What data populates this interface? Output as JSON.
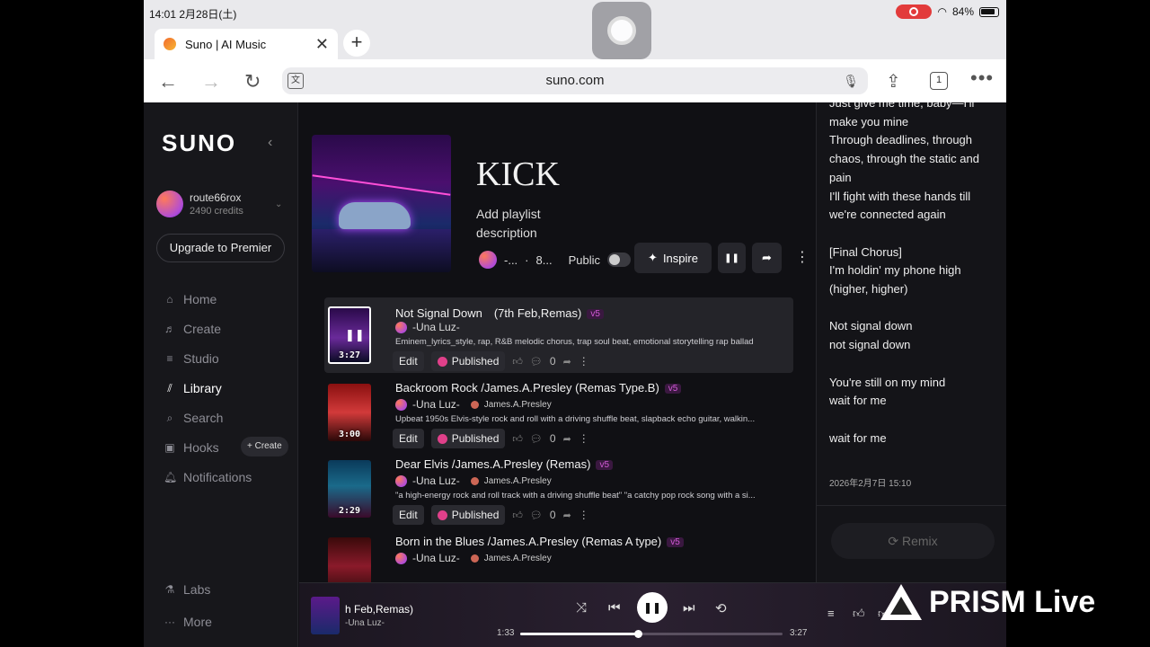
{
  "statusbar": {
    "time": "14:01  2月28日(土)",
    "battery": "84%"
  },
  "browser": {
    "tab_title": "Suno | AI Music",
    "url": "suno.com",
    "tab_count": "1"
  },
  "sidebar": {
    "logo": "SUNO",
    "username": "route66rox",
    "credits": "2490 credits",
    "upgrade": "Upgrade to Premier",
    "items": [
      {
        "label": "Home",
        "icon": "home-icon"
      },
      {
        "label": "Create",
        "icon": "music-note-icon"
      },
      {
        "label": "Studio",
        "icon": "studio-icon"
      },
      {
        "label": "Library",
        "icon": "library-icon"
      },
      {
        "label": "Search",
        "icon": "search-icon"
      },
      {
        "label": "Hooks",
        "icon": "hooks-icon"
      },
      {
        "label": "Notifications",
        "icon": "bell-icon"
      },
      {
        "label": "Labs",
        "icon": "flask-icon"
      },
      {
        "label": "More",
        "icon": "more-icon"
      }
    ],
    "hooks_create": "+ Create"
  },
  "playlist": {
    "title": "KICK",
    "description": "Add playlist description",
    "owner_short": "-...",
    "count_short": "8...",
    "public_label": "Public",
    "inspire": "Inspire"
  },
  "songs": [
    {
      "title": "Not Signal Down　(7th Feb,Remas)",
      "version": "v5",
      "artist": "-Una Luz-",
      "collab": "",
      "tags": "Eminem_lyrics_style, rap, R&B melodic chorus, trap soul beat, emotional storytelling rap ballad",
      "duration": "3:27",
      "edit": "Edit",
      "status": "Published",
      "comments": "0"
    },
    {
      "title": "Backroom Rock /James.A.Presley (Remas Type.B)",
      "version": "v5",
      "artist": "-Una Luz-",
      "collab": "James.A.Presley",
      "tags": "Upbeat 1950s Elvis-style rock and roll with a driving shuffle beat, slapback echo guitar, walkin...",
      "duration": "3:00",
      "edit": "Edit",
      "status": "Published",
      "comments": "0"
    },
    {
      "title": "Dear Elvis /James.A.Presley (Remas)",
      "version": "v5",
      "artist": "-Una Luz-",
      "collab": "James.A.Presley",
      "tags": "\"a high-energy rock and roll track with a driving shuffle beat\" \"a catchy pop rock song with a si...",
      "duration": "2:29",
      "edit": "Edit",
      "status": "Published",
      "comments": "0"
    },
    {
      "title": "Born in the Blues /James.A.Presley (Remas A type)",
      "version": "v5",
      "artist": "-Una Luz-",
      "collab": "James.A.Presley",
      "tags": "",
      "duration": "",
      "edit": "",
      "status": "",
      "comments": ""
    }
  ],
  "lyrics": {
    "text": "Just give me time, baby—I'll\nmake you mine\nThrough deadlines, through\nchaos, through the static and\npain\nI'll fight with these hands till\nwe're connected again\n\n[Final Chorus]\nI'm holdin' my phone high\n(higher, higher)\n\nNot signal down\nnot signal down\n\nYou're still on my mind\nwait for me\n\nwait for me",
    "date": "2026年2月7日 15:10",
    "remix": "Remix"
  },
  "player": {
    "title": "h Feb,Remas)",
    "artist": "-Una Luz-",
    "elapsed": "1:33",
    "total": "3:27",
    "progress": 0.45
  },
  "watermark": "PRISM Live"
}
